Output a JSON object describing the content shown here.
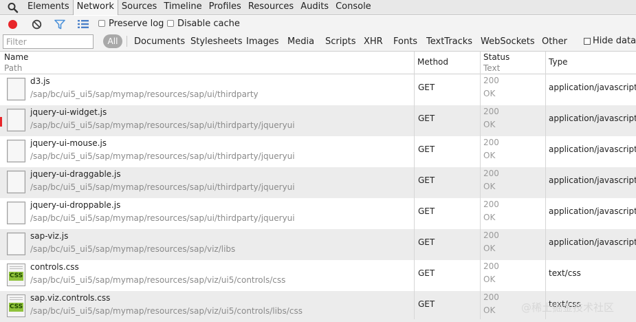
{
  "tabs": [
    "Elements",
    "Network",
    "Sources",
    "Timeline",
    "Profiles",
    "Resources",
    "Audits",
    "Console"
  ],
  "active_tab": "Network",
  "toolbar": {
    "preserve_log": "Preserve log",
    "disable_cache": "Disable cache"
  },
  "filter": {
    "placeholder": "Filter",
    "all_label": "All",
    "types": [
      "Documents",
      "Stylesheets",
      "Images",
      "Media",
      "Scripts",
      "XHR",
      "Fonts",
      "TextTracks",
      "WebSockets",
      "Other"
    ],
    "hide_data_label": "Hide data"
  },
  "columns": {
    "name": "Name",
    "path": "Path",
    "method": "Method",
    "status": "Status",
    "text": "Text",
    "type": "Type"
  },
  "rows": [
    {
      "name": "d3.js",
      "path": "/sap/bc/ui5_ui5/sap/mymap/resources/sap/ui/thirdparty",
      "method": "GET",
      "status": "200",
      "text": "OK",
      "type": "application/javascript",
      "icon": "file-icon"
    },
    {
      "name": "jquery-ui-widget.js",
      "path": "/sap/bc/ui5_ui5/sap/mymap/resources/sap/ui/thirdparty/jqueryui",
      "method": "GET",
      "status": "200",
      "text": "OK",
      "type": "application/javascript",
      "icon": "file-icon"
    },
    {
      "name": "jquery-ui-mouse.js",
      "path": "/sap/bc/ui5_ui5/sap/mymap/resources/sap/ui/thirdparty/jqueryui",
      "method": "GET",
      "status": "200",
      "text": "OK",
      "type": "application/javascript",
      "icon": "file-icon"
    },
    {
      "name": "jquery-ui-draggable.js",
      "path": "/sap/bc/ui5_ui5/sap/mymap/resources/sap/ui/thirdparty/jqueryui",
      "method": "GET",
      "status": "200",
      "text": "OK",
      "type": "application/javascript",
      "icon": "file-icon"
    },
    {
      "name": "jquery-ui-droppable.js",
      "path": "/sap/bc/ui5_ui5/sap/mymap/resources/sap/ui/thirdparty/jqueryui",
      "method": "GET",
      "status": "200",
      "text": "OK",
      "type": "application/javascript",
      "icon": "file-icon"
    },
    {
      "name": "sap-viz.js",
      "path": "/sap/bc/ui5_ui5/sap/mymap/resources/sap/viz/libs",
      "method": "GET",
      "status": "200",
      "text": "OK",
      "type": "application/javascript",
      "icon": "file-icon"
    },
    {
      "name": "controls.css",
      "path": "/sap/bc/ui5_ui5/sap/mymap/resources/sap/viz/ui5/controls/css",
      "method": "GET",
      "status": "200",
      "text": "OK",
      "type": "text/css",
      "icon": "css-file-icon",
      "icon_label": "CSS"
    },
    {
      "name": "sap.viz.controls.css",
      "path": "/sap/bc/ui5_ui5/sap/mymap/resources/sap/viz/ui5/controls/libs/css",
      "method": "GET",
      "status": "200",
      "text": "OK",
      "type": "text/css",
      "icon": "css-file-icon",
      "icon_label": "CSS"
    }
  ],
  "watermark": "@稀土掘金技术社区",
  "colors": {
    "record": "#e8262a",
    "filter_icon": "#4a90d9",
    "row_alt": "#ececec"
  }
}
